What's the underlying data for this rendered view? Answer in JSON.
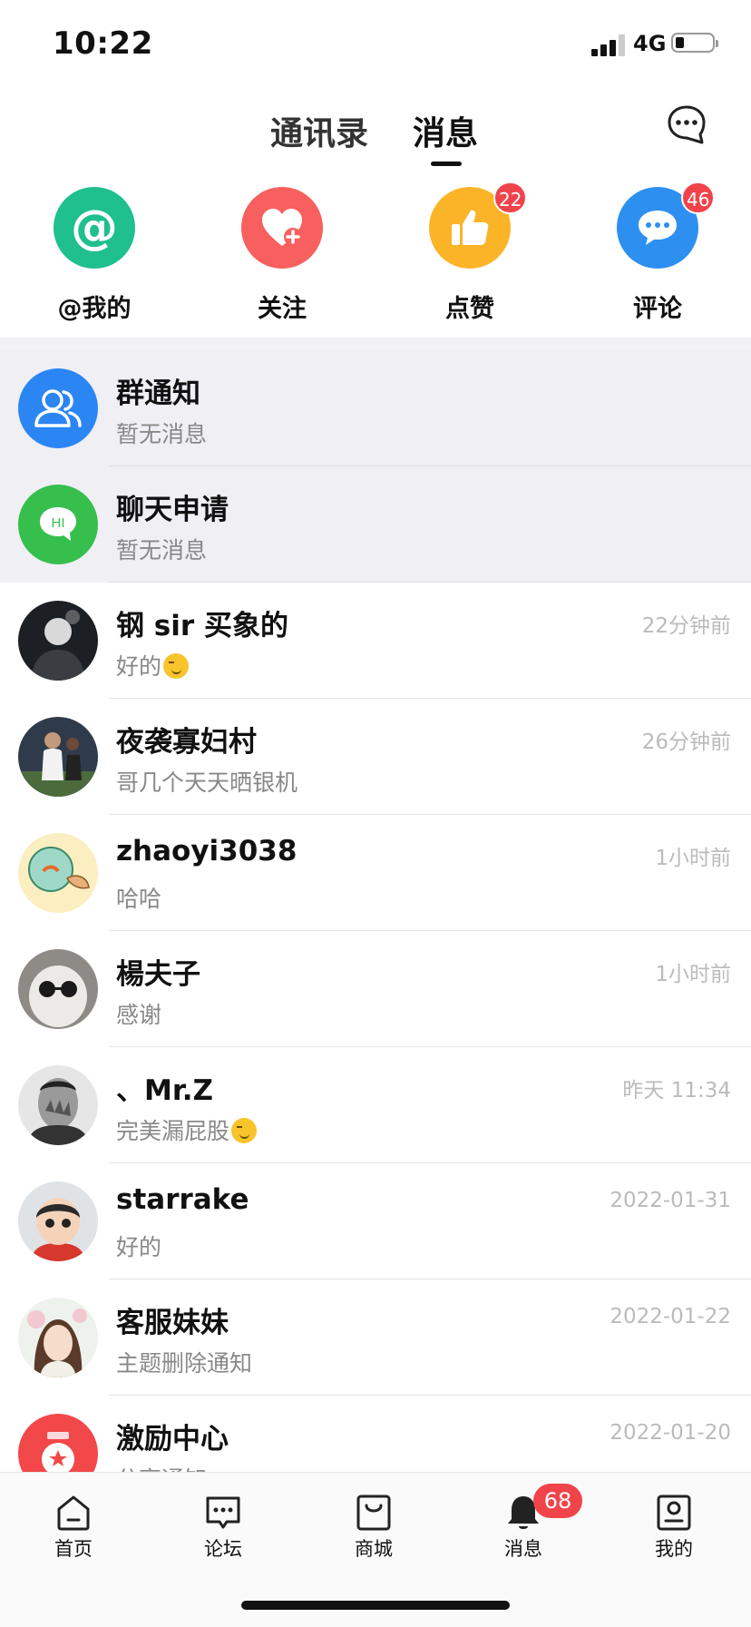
{
  "status_bar": {
    "time": "10:22",
    "network": "4G"
  },
  "header": {
    "tab_contacts": "通讯录",
    "tab_messages": "消息",
    "compose_icon": "chat-bubble-icon"
  },
  "quick_actions": [
    {
      "label": "@我的",
      "icon": "at-icon",
      "color": "#1fbf8e",
      "badge": ""
    },
    {
      "label": "关注",
      "icon": "heart-plus-icon",
      "color": "#f7605e",
      "badge": ""
    },
    {
      "label": "点赞",
      "icon": "thumbs-up-icon",
      "color": "#fbb428",
      "badge": "22"
    },
    {
      "label": "评论",
      "icon": "comment-icon",
      "color": "#2d8ff0",
      "badge": "46"
    }
  ],
  "system_rows": [
    {
      "name": "群通知",
      "preview": "暂无消息",
      "avatar_icon": "group-icon",
      "color": "#2b86f3"
    },
    {
      "name": "聊天申请",
      "preview": "暂无消息",
      "avatar_icon": "hi-chat-icon",
      "color": "#37bf4e"
    }
  ],
  "conversations": [
    {
      "name": "钢 sir 买象的",
      "preview": "好的",
      "emoji": true,
      "time": "22分钟前"
    },
    {
      "name": "夜袭寡妇村",
      "preview": "哥几个天天晒银机",
      "emoji": false,
      "time": "26分钟前"
    },
    {
      "name": "zhaoyi3038",
      "preview": "哈哈",
      "emoji": false,
      "time": "1小时前"
    },
    {
      "name": "楊夫子",
      "preview": "感谢",
      "emoji": false,
      "time": "1小时前"
    },
    {
      "name": "、Mr.Z",
      "preview": "完美漏屁股",
      "emoji": true,
      "time": "昨天 11:34"
    },
    {
      "name": "starrake",
      "preview": "好的",
      "emoji": false,
      "time": "2022-01-31"
    },
    {
      "name": "客服妹妹",
      "preview": "主题删除通知",
      "emoji": false,
      "time": "2022-01-22"
    },
    {
      "name": "激励中心",
      "preview": "分享通知",
      "emoji": false,
      "time": "2022-01-20"
    }
  ],
  "bottom_nav": [
    {
      "label": "首页",
      "icon": "home-icon"
    },
    {
      "label": "论坛",
      "icon": "forum-icon"
    },
    {
      "label": "商城",
      "icon": "shop-bag-icon"
    },
    {
      "label": "消息",
      "icon": "bell-icon",
      "badge": "68"
    },
    {
      "label": "我的",
      "icon": "profile-icon"
    }
  ]
}
